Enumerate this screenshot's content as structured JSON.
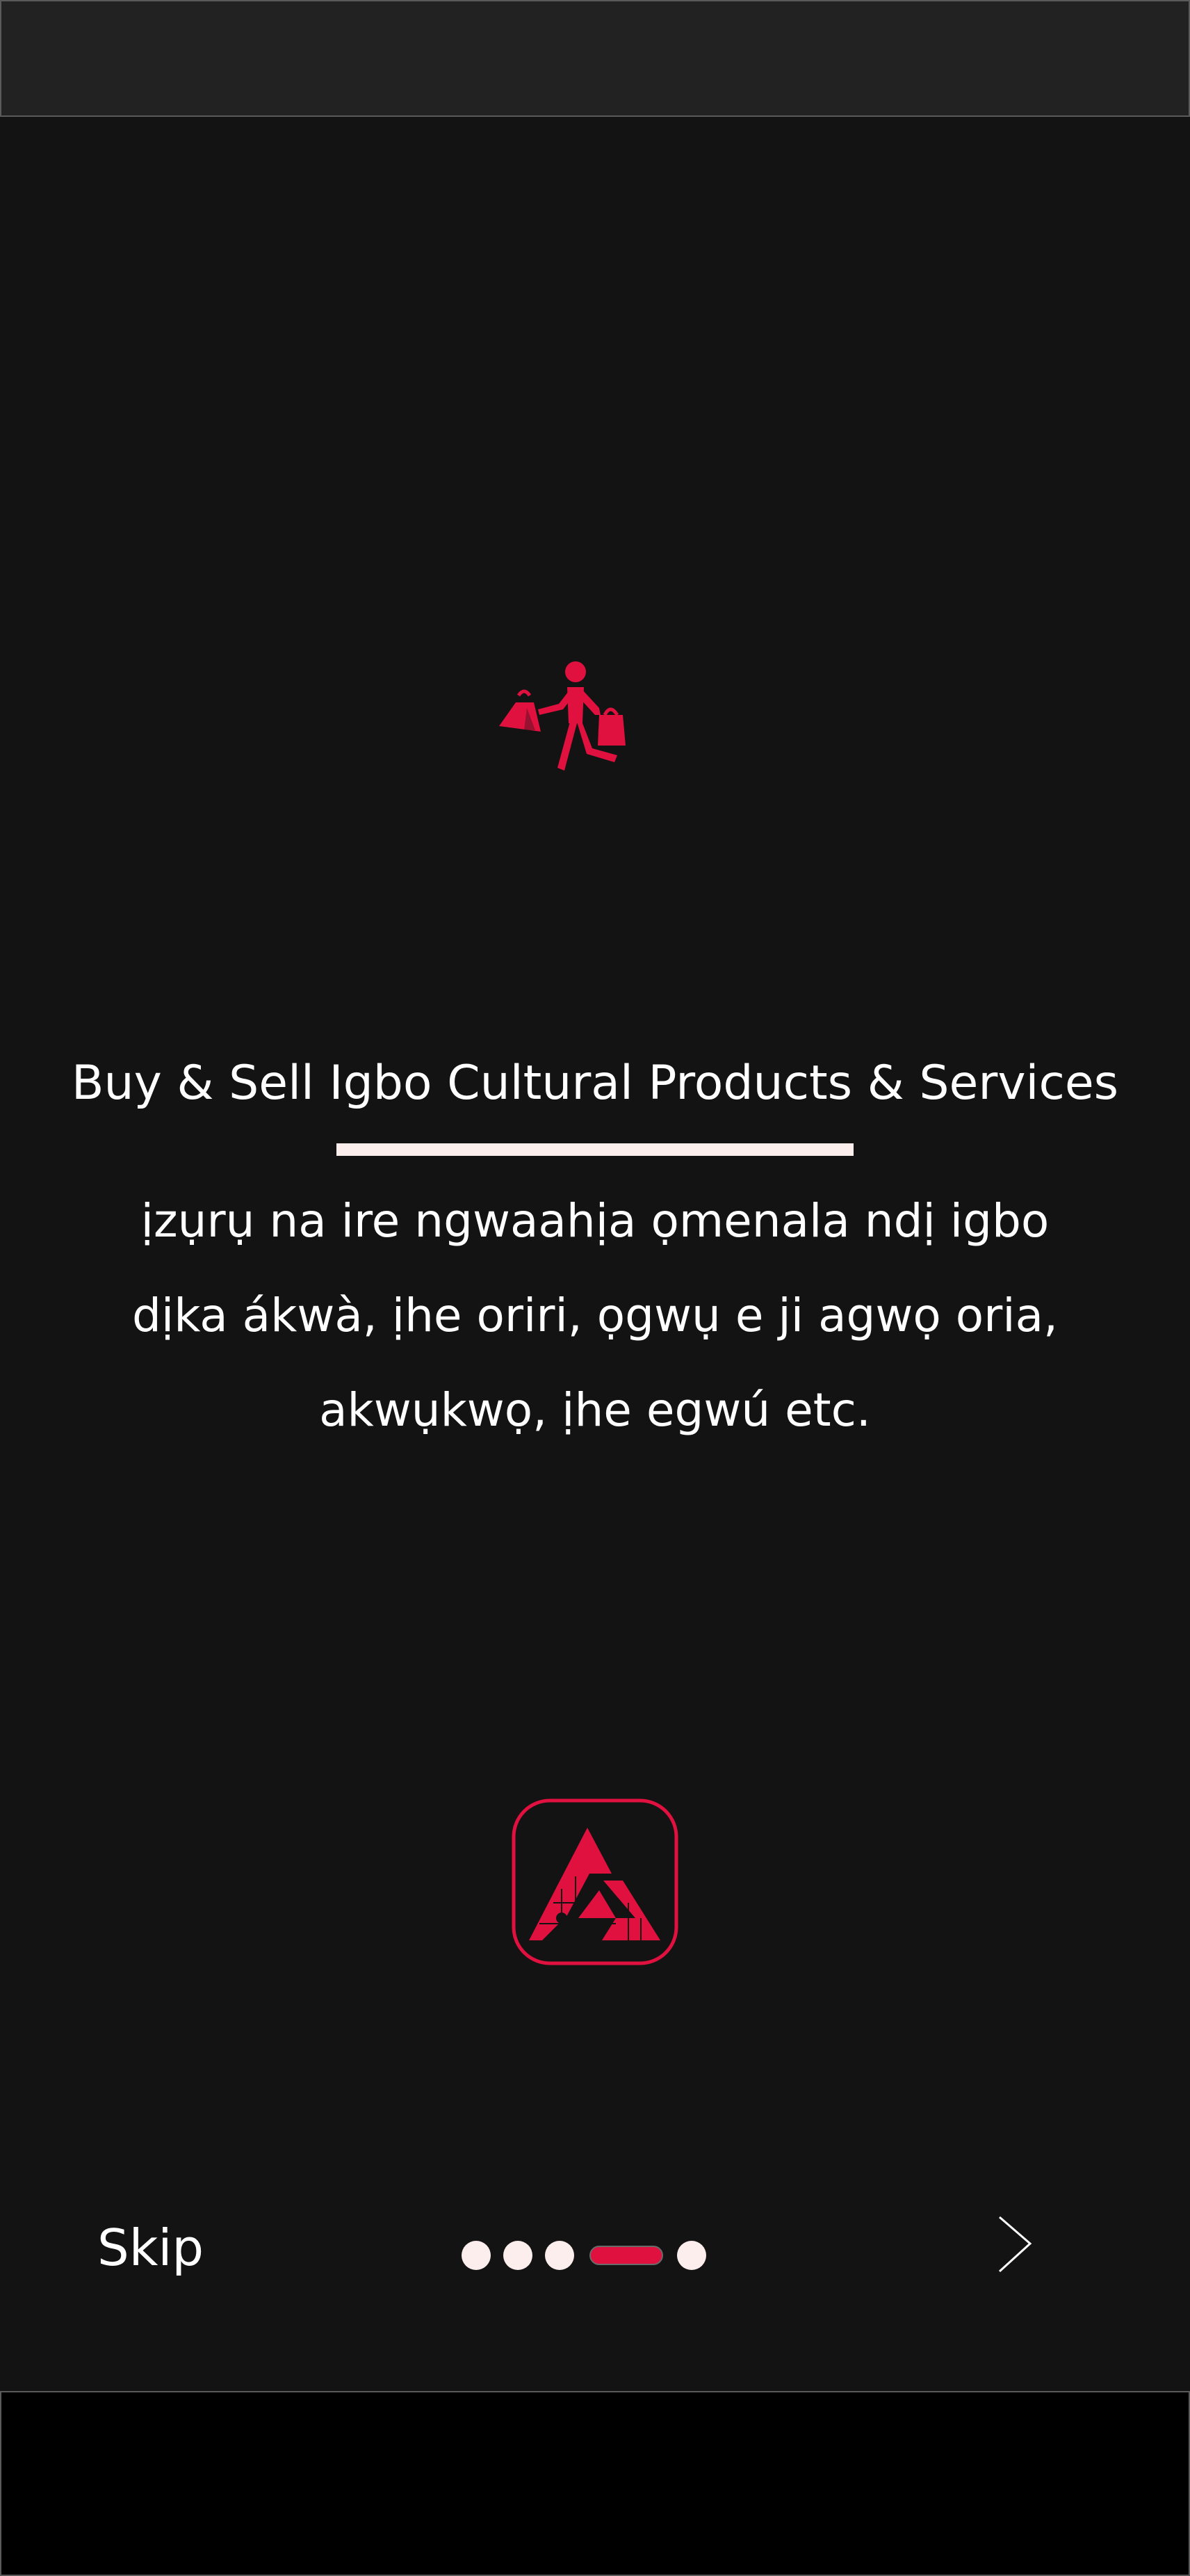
{
  "onboarding": {
    "title": "Buy & Sell Igbo Cultural Products & Services",
    "description_lines": [
      "ịzụrụ na ire ngwaahịa ọmenala ndị igbo",
      "dịka ákwà, ịhe oriri, ọgwụ e ji agwọ oria,",
      "akwụkwọ, ịhe egwú etc."
    ],
    "hero_icon": "shopping-person-icon",
    "brand_logo": "app-logo-icon"
  },
  "footer": {
    "skip_label": "Skip",
    "next_icon": "chevron-right-icon",
    "pager": {
      "total": 5,
      "active_index": 3
    }
  },
  "colors": {
    "background": "#131313",
    "accent": "#e0103f",
    "text": "#ffffff",
    "dot": "#fdeeee",
    "status_bar": "#222222",
    "nav_bar": "#000000"
  }
}
